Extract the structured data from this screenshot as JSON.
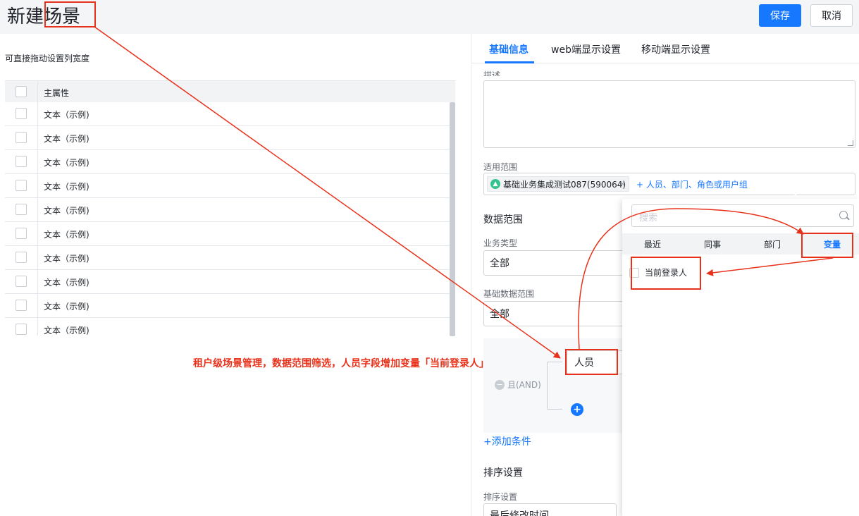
{
  "header": {
    "title": "新建场景",
    "save_label": "保存",
    "cancel_label": "取消"
  },
  "left_panel": {
    "hint": "可直接拖动设置列宽度",
    "table": {
      "column_header": "主属性",
      "rows": [
        "文本（示例)",
        "文本（示例)",
        "文本（示例)",
        "文本（示例)",
        "文本（示例)",
        "文本（示例)",
        "文本（示例)",
        "文本（示例)",
        "文本（示例)",
        "文本（示例)"
      ]
    }
  },
  "right_panel": {
    "tabs": [
      "基础信息",
      "web端显示设置",
      "移动端显示设置"
    ],
    "active_tab": "基础信息",
    "description_label": "描述",
    "scope_label": "适用范围",
    "scope_chip": "基础业务集成测试087(590064)",
    "scope_add": "+ 人员、部门、角色或用户组",
    "data_scope_title": "数据范围",
    "business_type_label": "业务类型",
    "business_type_value": "全部",
    "base_data_label": "基础数据范围",
    "base_data_value": "全部",
    "condition": {
      "logic": "且(AND)",
      "field_value": "人员"
    },
    "add_condition": "+添加条件",
    "sort_title": "排序设置",
    "sort_label": "排序设置",
    "sort_value": "最后修改时间"
  },
  "dropdown": {
    "search_placeholder": "搜索",
    "tabs": [
      "最近",
      "同事",
      "部门",
      "变量"
    ],
    "active_tab": "变量",
    "items": [
      "当前登录人"
    ]
  },
  "annotation": {
    "text": "租户级场景管理，数据范围筛选，人员字段增加变量「当前登录人」",
    "color": "#e8311a"
  },
  "colors": {
    "primary": "#1677ff",
    "annotation": "#e8311a"
  }
}
